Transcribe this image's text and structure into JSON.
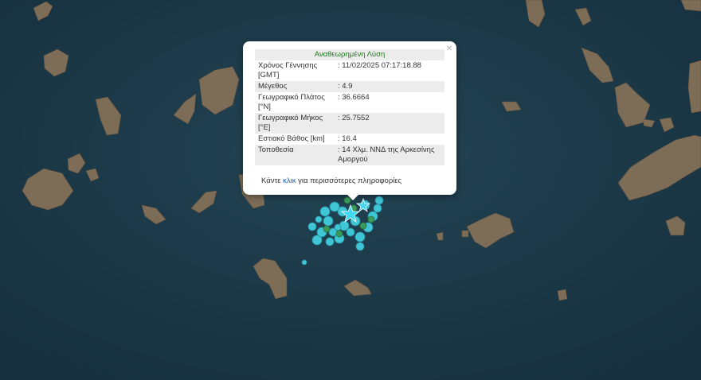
{
  "popup": {
    "title": "Αναθεωρημένη Λύση",
    "close_icon": "×",
    "rows": [
      {
        "key": "Χρόνος Γέννησης [GMT]",
        "value": ": 11/02/2025 07:17:18.88"
      },
      {
        "key": "Μέγεθος",
        "value": ": 4.9"
      },
      {
        "key": "Γεωγραφικό Πλάτος [°N]",
        "value": ": 36.6664"
      },
      {
        "key": "Γεωγραφικό Μήκος [°E]",
        "value": ": 25.7552"
      },
      {
        "key": "Εστιακό Βάθος [km]",
        "value": ": 16.4"
      },
      {
        "key": "Τοποθεσία",
        "value": ": 14 Χλμ. ΝΝΔ της Αρκεσίνης Αμοργού"
      }
    ],
    "more_prefix": "Κάντε ",
    "more_link": "κλικ",
    "more_suffix": " για περισσότερες πληροφορίες"
  },
  "colors": {
    "sea": "#1c3a4a",
    "land": "#7a6a55",
    "quake_cyan": "#3fc6d6",
    "quake_green": "#3a9a5a",
    "star": "#40d8f0"
  }
}
